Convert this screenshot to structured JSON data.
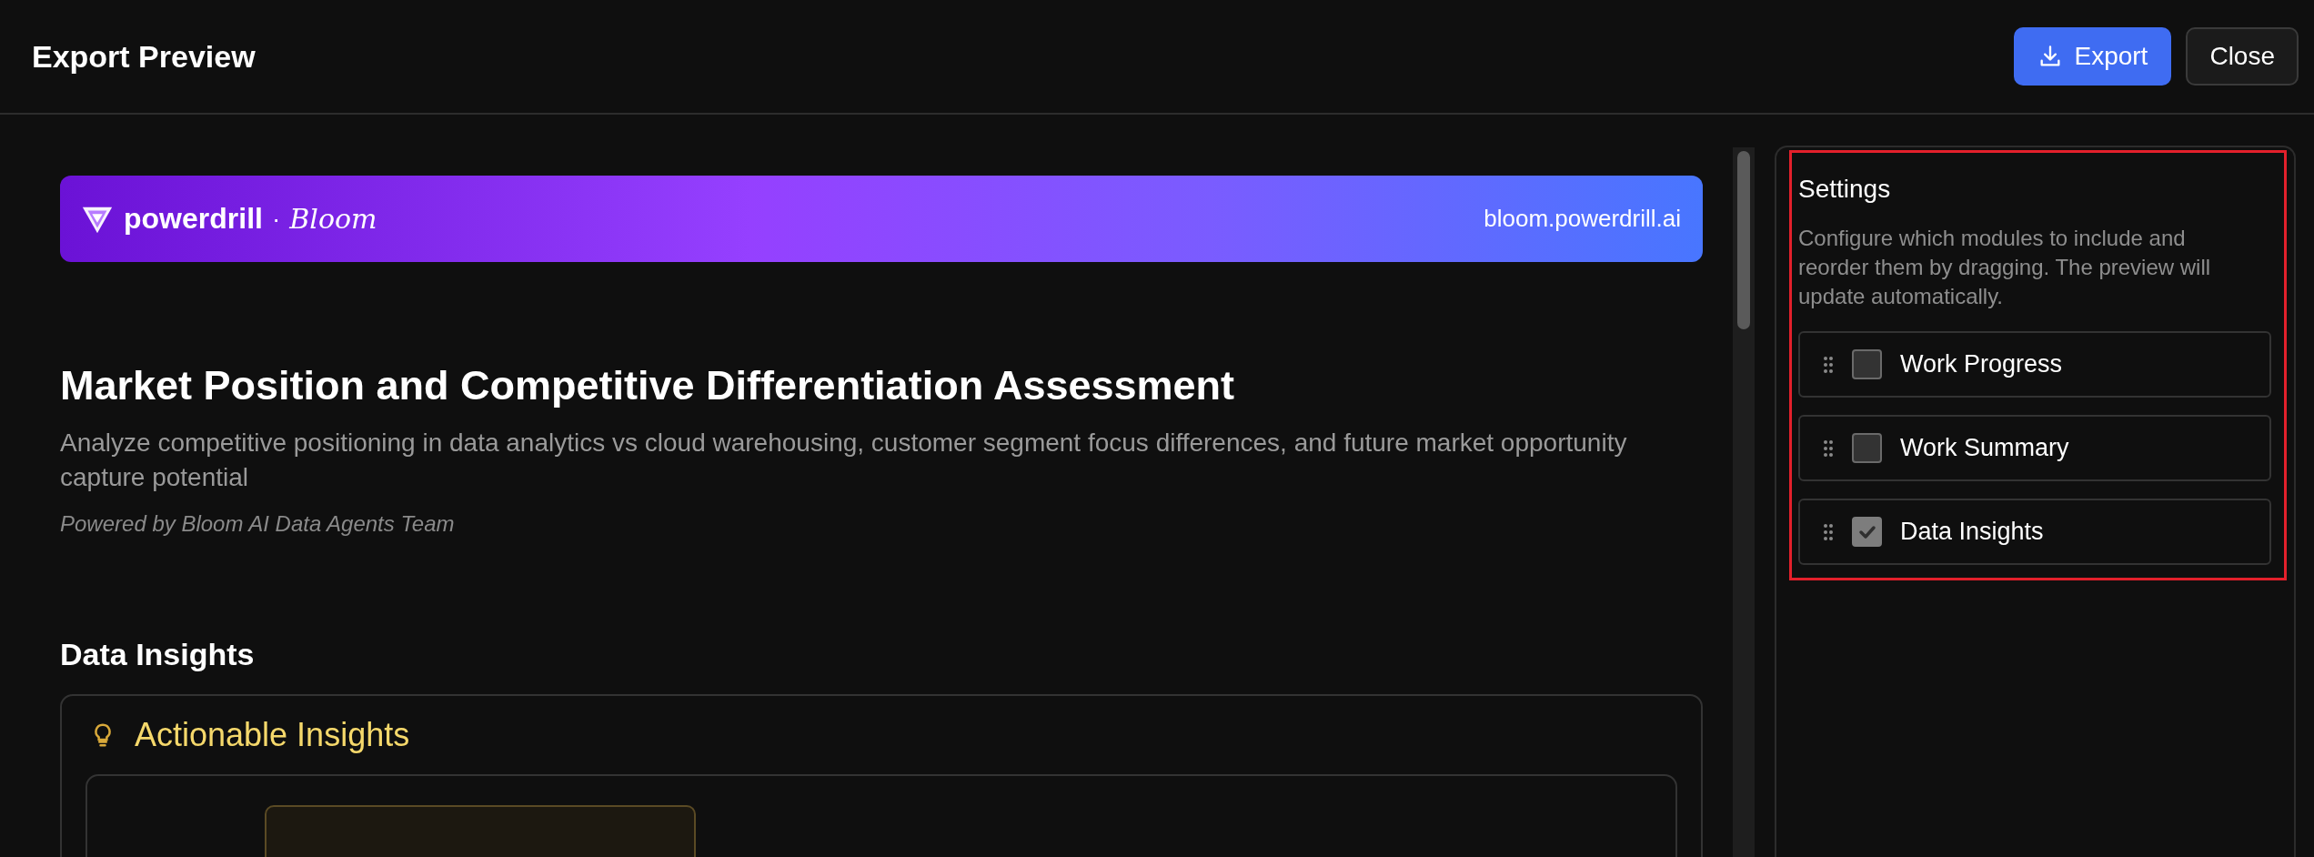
{
  "window": {
    "title": "Export Preview"
  },
  "actions": [
    {
      "label": "Export",
      "kind": "primary"
    },
    {
      "label": "Close",
      "kind": "secondary"
    }
  ],
  "preview": {
    "banner": {
      "brand": "powerdrill",
      "separator": "·",
      "product": "Bloom",
      "url": "bloom.powerdrill.ai"
    },
    "title": "Market Position and Competitive Differentiation Assessment",
    "description": "Analyze competitive positioning in data analytics vs cloud warehousing, customer segment focus differences, and future market opportunity capture potential",
    "credit": "Powered by Bloom AI Data Agents Team",
    "section": {
      "heading": "Data Insights",
      "card_title": "Actionable Insights"
    }
  },
  "settings": {
    "highlighted": true,
    "title": "Settings",
    "description": "Configure which modules to include and reorder them by dragging. The preview will update automatically.",
    "modules": [
      {
        "label": "Work Progress",
        "checked": false
      },
      {
        "label": "Work Summary",
        "checked": false
      },
      {
        "label": "Data Insights",
        "checked": true
      }
    ]
  }
}
